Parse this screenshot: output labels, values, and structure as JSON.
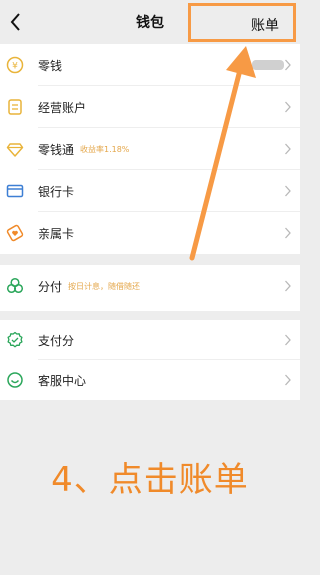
{
  "header": {
    "title": "钱包",
    "bill_label": "账单"
  },
  "wallet": {
    "change": {
      "label": "零钱",
      "balance_prefix": "¥"
    },
    "business_account": {
      "label": "经营账户"
    },
    "licaitong": {
      "label": "零钱通",
      "tag": "收益率1.18%"
    },
    "bank_card": {
      "label": "银行卡"
    },
    "family_card": {
      "label": "亲属卡"
    }
  },
  "fenfu": {
    "label": "分付",
    "tag": "按日计息，随借随还"
  },
  "services": {
    "pay_score": {
      "label": "支付分"
    },
    "customer_service": {
      "label": "客服中心"
    }
  },
  "caption": "4、点击账单",
  "colors": {
    "accent": "#f79a45",
    "caption": "#f08a2a",
    "tag": "#e4a74b",
    "icon_yellow": "#e9b43a",
    "icon_orange": "#f08a2a",
    "icon_blue": "#3d7fd4",
    "icon_green": "#2aa65a"
  },
  "icons": {
    "back": "chevron-left-icon",
    "change": "coin-icon",
    "business_account": "ledger-icon",
    "licaitong": "diamond-icon",
    "bank_card": "card-icon",
    "family_card": "heart-card-icon",
    "fenfu": "clover-icon",
    "pay_score": "score-badge-icon",
    "customer_service": "headset-icon"
  }
}
